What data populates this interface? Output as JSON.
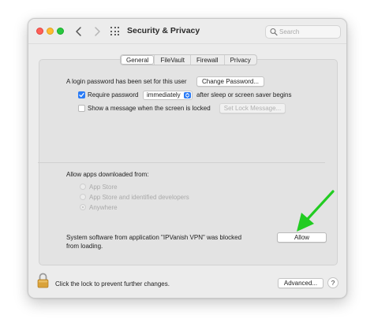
{
  "window": {
    "title": "Security & Privacy"
  },
  "search": {
    "placeholder": "Search"
  },
  "tabs": [
    {
      "label": "General",
      "active": true
    },
    {
      "label": "FileVault",
      "active": false
    },
    {
      "label": "Firewall",
      "active": false
    },
    {
      "label": "Privacy",
      "active": false
    }
  ],
  "general": {
    "login_password_text": "A login password has been set for this user",
    "change_password_label": "Change Password...",
    "require_password_label": "Require password",
    "require_password_checked": true,
    "require_password_value": "immediately",
    "require_password_suffix": "after sleep or screen saver begins",
    "show_message_label": "Show a message when the screen is locked",
    "show_message_checked": false,
    "set_lock_message_label": "Set Lock Message..."
  },
  "allow_apps": {
    "heading": "Allow apps downloaded from:",
    "options": [
      {
        "label": "App Store",
        "selected": false
      },
      {
        "label": "App Store and identified developers",
        "selected": false
      },
      {
        "label": "Anywhere",
        "selected": true
      }
    ]
  },
  "blocked": {
    "message_line1": "System software from application \"IPVanish VPN\" was blocked",
    "message_line2": "from loading.",
    "allow_label": "Allow"
  },
  "footer": {
    "lock_text": "Click the lock to prevent further changes.",
    "advanced_label": "Advanced...",
    "help_label": "?"
  },
  "colors": {
    "accent": "#2a7bf6",
    "arrow": "#22cc22",
    "close": "#ff5f57",
    "minimize": "#febc2e",
    "zoom": "#28c840"
  }
}
